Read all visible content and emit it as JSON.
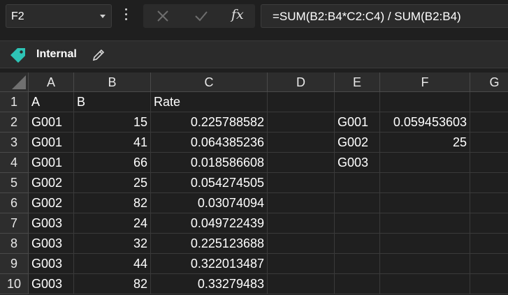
{
  "formula_bar": {
    "name_box": "F2",
    "fx_label": "fx",
    "formula": "=SUM(B2:B4*C2:C4) / SUM(B2:B4)"
  },
  "label_bar": {
    "label": "Internal"
  },
  "columns": [
    "A",
    "B",
    "C",
    "D",
    "E",
    "F",
    "G"
  ],
  "rows": [
    {
      "num": "1",
      "A": "A",
      "B": "B",
      "C": "Rate",
      "E": "",
      "F": ""
    },
    {
      "num": "2",
      "A": "G001",
      "B": "15",
      "C": "0.225788582",
      "E": "G001",
      "F": "0.059453603"
    },
    {
      "num": "3",
      "A": "G001",
      "B": "41",
      "C": "0.064385236",
      "E": "G002",
      "F": "25"
    },
    {
      "num": "4",
      "A": "G001",
      "B": "66",
      "C": "0.018586608",
      "E": "G003",
      "F": ""
    },
    {
      "num": "5",
      "A": "G002",
      "B": "25",
      "C": "0.054274505",
      "E": "",
      "F": ""
    },
    {
      "num": "6",
      "A": "G002",
      "B": "82",
      "C": "0.03074094",
      "E": "",
      "F": ""
    },
    {
      "num": "7",
      "A": "G003",
      "B": "24",
      "C": "0.049722439",
      "E": "",
      "F": ""
    },
    {
      "num": "8",
      "A": "G003",
      "B": "32",
      "C": "0.225123688",
      "E": "",
      "F": ""
    },
    {
      "num": "9",
      "A": "G003",
      "B": "44",
      "C": "0.322013487",
      "E": "",
      "F": ""
    },
    {
      "num": "10",
      "A": "G003",
      "B": "82",
      "C": "0.33279483",
      "E": "",
      "F": ""
    }
  ],
  "colors": {
    "background": "#1f1f1f",
    "header": "#2d2d2d",
    "gridline": "#3a3a3a",
    "tag_accent": "#2ec4b6"
  },
  "icons": {
    "name_box_dropdown": "chevron-down-icon",
    "more": "more-vertical-icon",
    "cancel": "close-icon",
    "enter": "check-icon",
    "insert_function": "fx-icon",
    "label": "tag-icon",
    "edit_label": "pencil-icon"
  }
}
